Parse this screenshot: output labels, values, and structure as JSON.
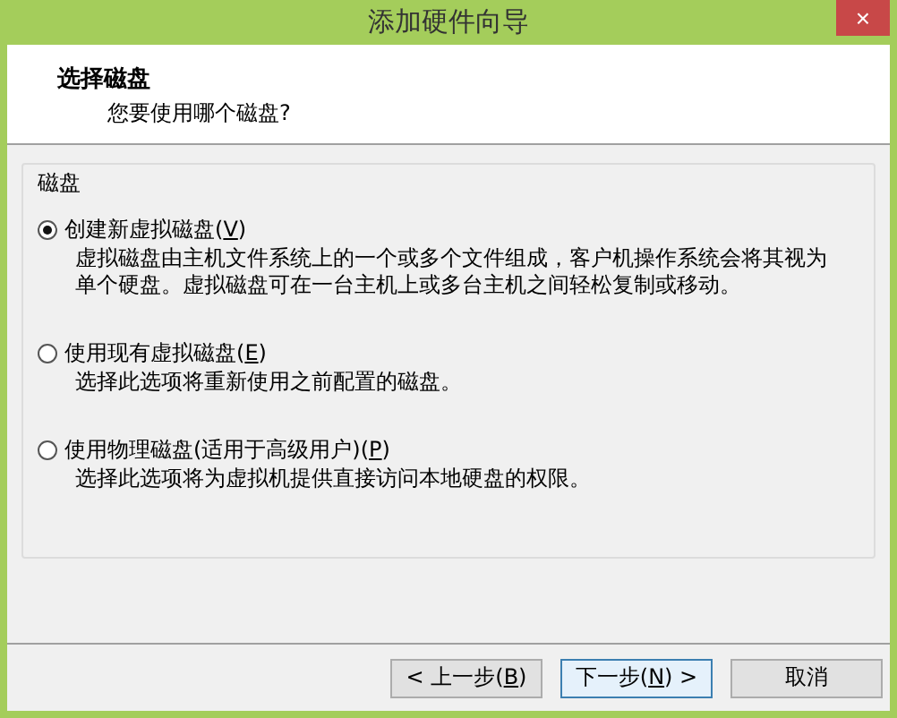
{
  "window": {
    "title": "添加硬件向导",
    "close": "×"
  },
  "header": {
    "title": "选择磁盘",
    "subtitle": "您要使用哪个磁盘?"
  },
  "group": {
    "title": "磁盘",
    "options": [
      {
        "before": "创建新虚拟磁盘(",
        "accel": "V",
        "after": ")",
        "description": "虚拟磁盘由主机文件系统上的一个或多个文件组成，客户机操作系统会将其视为单个硬盘。虚拟磁盘可在一台主机上或多台主机之间轻松复制或移动。",
        "selected": true
      },
      {
        "before": "使用现有虚拟磁盘(",
        "accel": "E",
        "after": ")",
        "description": "选择此选项将重新使用之前配置的磁盘。",
        "selected": false
      },
      {
        "before": "使用物理磁盘(适用于高级用户)(",
        "accel": "P",
        "after": ")",
        "description": "选择此选项将为虚拟机提供直接访问本地硬盘的权限。",
        "selected": false
      }
    ]
  },
  "buttons": [
    {
      "before": "< 上一步(",
      "accel": "B",
      "after": ")",
      "focused": false
    },
    {
      "before": "下一步(",
      "accel": "N",
      "after": ") >",
      "focused": true
    },
    {
      "before": "取消",
      "focused": false
    }
  ]
}
